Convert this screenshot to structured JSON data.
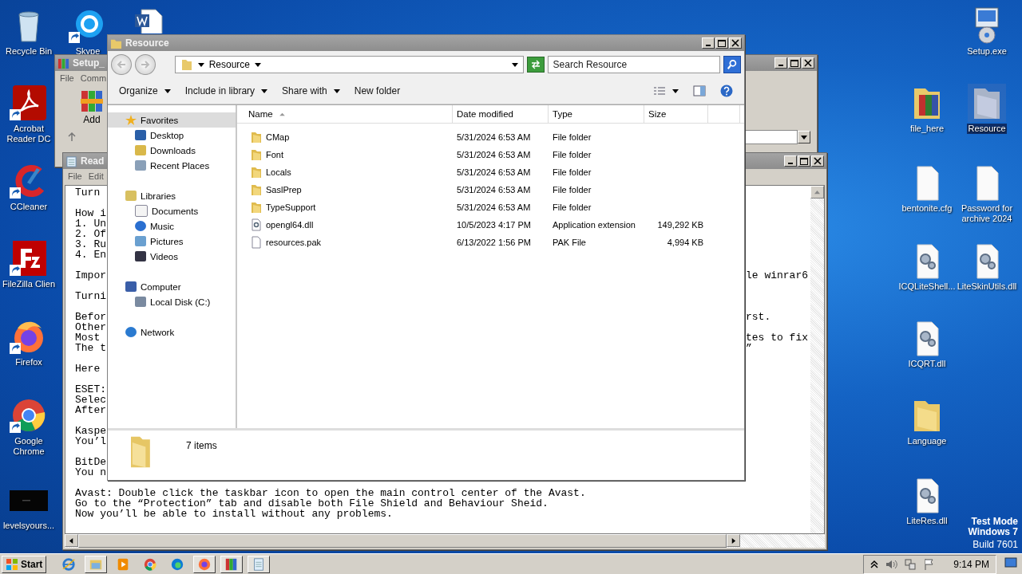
{
  "desktop_icons": [
    {
      "label": "Recycle Bin",
      "kind": "recycle-bin",
      "shortcut": false,
      "selected": false
    },
    {
      "label": "Skype",
      "kind": "skype",
      "shortcut": true,
      "selected": false
    },
    {
      "kind": "word-doc",
      "shortcut": false,
      "selected": false
    },
    {
      "label": "Acrobat Reader DC",
      "kind": "acrobat",
      "shortcut": true,
      "selected": false
    },
    {
      "label": "CCleaner",
      "kind": "ccleaner",
      "shortcut": true,
      "selected": false
    },
    {
      "label": "FileZilla Clien",
      "kind": "filezilla",
      "shortcut": true,
      "selected": false
    },
    {
      "label": "Firefox",
      "kind": "firefox",
      "shortcut": true,
      "selected": false
    },
    {
      "label": "Google Chrome",
      "kind": "chrome",
      "shortcut": true,
      "selected": false
    },
    {
      "label": "levelsyours...",
      "kind": "thumbnail",
      "shortcut": false,
      "selected": false
    },
    {
      "label": "Setup.exe",
      "kind": "setup",
      "shortcut": false,
      "selected": false
    },
    {
      "label": "file_here",
      "kind": "archive-folder",
      "shortcut": false,
      "selected": false
    },
    {
      "label": "Resource",
      "kind": "folder",
      "shortcut": false,
      "selected": true
    },
    {
      "label": "bentonite.cfg",
      "kind": "file",
      "shortcut": false,
      "selected": false
    },
    {
      "label": "Password for archive 2024",
      "kind": "file",
      "shortcut": false,
      "selected": false
    },
    {
      "label": "ICQLiteShell...",
      "kind": "dll",
      "shortcut": false,
      "selected": false
    },
    {
      "label": "LiteSkinUtils.dll",
      "kind": "dll",
      "shortcut": false,
      "selected": false
    },
    {
      "label": "ICQRT.dll",
      "kind": "dll",
      "shortcut": false,
      "selected": false
    },
    {
      "label": "Language",
      "kind": "folder",
      "shortcut": false,
      "selected": false
    },
    {
      "label": "LiteRes.dll",
      "kind": "dll",
      "shortcut": false,
      "selected": false
    }
  ],
  "winrar_window": {
    "title": "Setup_",
    "menu": [
      "File",
      "Comm"
    ],
    "toolbar": [
      "Add"
    ]
  },
  "notepad_window": {
    "title": "Read",
    "menu": [
      "File",
      "Edit"
    ],
    "paragraphs": [
      {
        "lines": [
          {
            "left": "Turn"
          }
        ]
      },
      {
        "lines": [
          {
            "left": "How i"
          },
          {
            "left": "1. Un"
          },
          {
            "left": "2. Of"
          },
          {
            "left": "3. Ru"
          },
          {
            "left": "4. En"
          }
        ]
      },
      {
        "lines": [
          {
            "left": "Impor",
            "right": "le winrar6"
          }
        ]
      },
      {
        "lines": [
          {
            "left": "Turni"
          }
        ]
      },
      {
        "lines": [
          {
            "left": "Befor",
            "right": "rst."
          },
          {
            "left": "Other"
          },
          {
            "left": "Most",
            "right": "tes to fix"
          },
          {
            "left": "The t",
            "right": "”"
          }
        ]
      },
      {
        "lines": [
          {
            "left": "Here"
          }
        ]
      },
      {
        "lines": [
          {
            "left": "ESET:"
          },
          {
            "left": "Selec"
          },
          {
            "left": "After"
          }
        ]
      },
      {
        "lines": [
          {
            "left": "Kaspe"
          },
          {
            "left": "You’l"
          }
        ]
      },
      {
        "lines": [
          {
            "left": "BitDe"
          },
          {
            "left": "You n"
          }
        ]
      },
      {
        "lines": [
          {
            "left": "Avast: Double click the taskbar icon to open the main control center of the Avast."
          },
          {
            "left": "Go to the “Protection” tab and disable both File Shield and Behaviour Sheid."
          },
          {
            "left": "Now you’ll be able to install without any problems."
          }
        ]
      }
    ]
  },
  "explorer_window": {
    "title": "Resource",
    "address": "Resource",
    "search": {
      "placeholder": "Search Resource"
    },
    "toolbar": [
      {
        "label": "Organize",
        "dropdown": true
      },
      {
        "label": "Include in library",
        "dropdown": true
      },
      {
        "label": "Share with",
        "dropdown": true
      },
      {
        "label": "New folder",
        "dropdown": false
      }
    ],
    "nav": [
      {
        "label": "Favorites",
        "kind": "star",
        "selected": true,
        "children": [
          {
            "label": "Desktop",
            "kind": "desktop",
            "selected": false
          },
          {
            "label": "Downloads",
            "kind": "downloads",
            "selected": false
          },
          {
            "label": "Recent Places",
            "kind": "recent",
            "selected": false
          }
        ]
      },
      {
        "label": "Libraries",
        "kind": "libraries",
        "selected": false,
        "children": [
          {
            "label": "Documents",
            "kind": "documents",
            "selected": false
          },
          {
            "label": "Music",
            "kind": "music",
            "selected": false
          },
          {
            "label": "Pictures",
            "kind": "pictures",
            "selected": false
          },
          {
            "label": "Videos",
            "kind": "videos",
            "selected": false
          }
        ]
      },
      {
        "label": "Computer",
        "kind": "computer",
        "selected": false,
        "children": [
          {
            "label": "Local Disk (C:)",
            "kind": "disk",
            "selected": false
          }
        ]
      },
      {
        "label": "Network",
        "kind": "network",
        "selected": false
      }
    ],
    "columns": [
      {
        "label": "Name",
        "sorted": true
      },
      {
        "label": "Date modified",
        "sorted": false
      },
      {
        "label": "Type",
        "sorted": false
      },
      {
        "label": "Size",
        "sorted": false
      }
    ],
    "files": [
      {
        "name": "CMap",
        "date": "5/31/2024 6:53 AM",
        "type": "File folder",
        "kind": "folder"
      },
      {
        "name": "Font",
        "date": "5/31/2024 6:53 AM",
        "type": "File folder",
        "kind": "folder"
      },
      {
        "name": "Locals",
        "date": "5/31/2024 6:53 AM",
        "type": "File folder",
        "kind": "folder"
      },
      {
        "name": "SaslPrep",
        "date": "5/31/2024 6:53 AM",
        "type": "File folder",
        "kind": "folder"
      },
      {
        "name": "TypeSupport",
        "date": "5/31/2024 6:53 AM",
        "type": "File folder",
        "kind": "folder"
      },
      {
        "name": "opengl64.dll",
        "date": "10/5/2023 4:17 PM",
        "type": "Application extension",
        "size": "149,292 KB",
        "kind": "dll"
      },
      {
        "name": "resources.pak",
        "date": "6/13/2022 1:56 PM",
        "type": "PAK File",
        "size": "4,994 KB",
        "kind": "file"
      }
    ],
    "status": "7 items"
  },
  "system_notice": [
    "Test Mode",
    "Windows 7",
    "Build 7601"
  ],
  "taskbar": {
    "start": "Start",
    "apps": [
      {
        "kind": "ie",
        "running": false
      },
      {
        "kind": "explorer",
        "running": true
      },
      {
        "kind": "media",
        "running": false
      },
      {
        "kind": "chrome",
        "running": false
      },
      {
        "kind": "edge",
        "running": false
      },
      {
        "kind": "firefox",
        "running": true
      },
      {
        "kind": "winrar",
        "running": true
      },
      {
        "kind": "notepad",
        "running": true
      }
    ],
    "clock": "9:14 PM"
  }
}
